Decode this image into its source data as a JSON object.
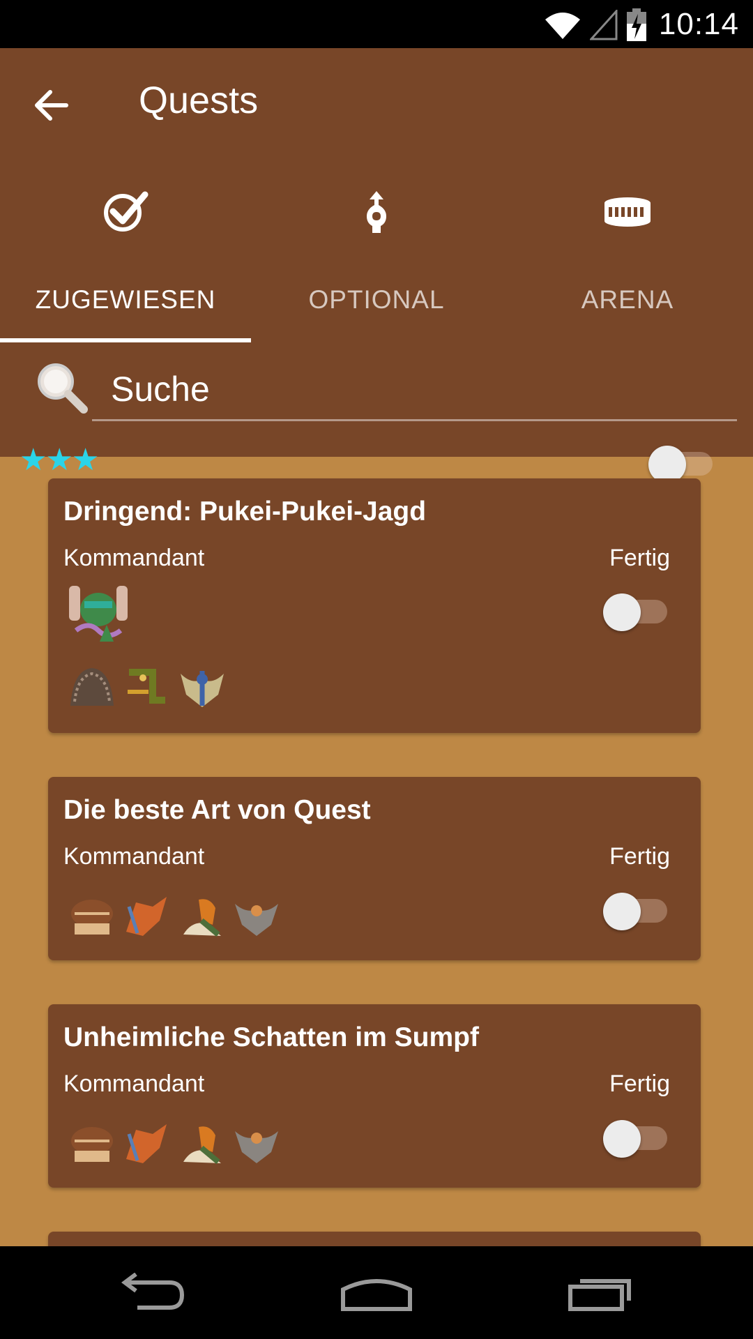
{
  "status_bar": {
    "time": "10:14",
    "icons": [
      "wifi-icon",
      "signal-icon",
      "battery-charging-icon"
    ]
  },
  "app_bar": {
    "title": "Quests",
    "back_icon": "arrow-left-icon"
  },
  "tabs": [
    {
      "label": "ZUGEWIESEN",
      "icon": "checkmark-icon",
      "active": true
    },
    {
      "label": "OPTIONAL",
      "icon": "path-icon",
      "active": false
    },
    {
      "label": "ARENA",
      "icon": "arena-icon",
      "active": false
    }
  ],
  "search": {
    "placeholder": "Suche",
    "icon": "magnifier-icon"
  },
  "filter": {
    "stars": "★★★",
    "toggle_on": false
  },
  "quests": [
    {
      "title": "Dringend: Pukei-Pukei-Jagd",
      "giver": "Kommandant",
      "done_label": "Fertig",
      "done": false
    },
    {
      "title": "Die beste Art von Quest",
      "giver": "Kommandant",
      "done_label": "Fertig",
      "done": false
    },
    {
      "title": "Unheimliche Schatten im Sumpf",
      "giver": "Kommandant",
      "done_label": "Fertig",
      "done": false
    }
  ],
  "nav_bar": {
    "icons": [
      "back-icon",
      "home-icon",
      "recents-icon"
    ]
  },
  "colors": {
    "primary": "#784628",
    "background": "#BE8845",
    "accent_star": "#2BD4E8"
  }
}
